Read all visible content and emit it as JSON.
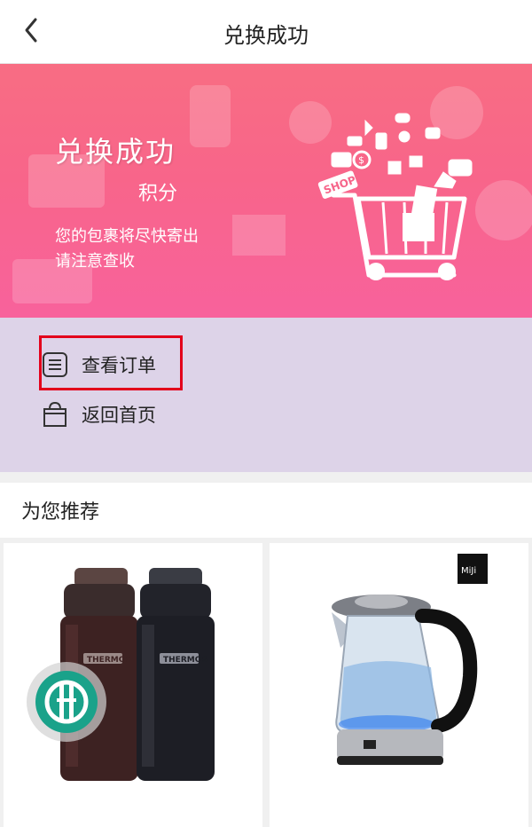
{
  "header": {
    "title": "兑换成功"
  },
  "banner": {
    "title": "兑换成功",
    "points_label": "积分",
    "line1": "您的包裹将尽快寄出",
    "line2": "请注意查收",
    "shop_tag": "SHOP"
  },
  "actions": {
    "view_order": "查看订单",
    "back_home": "返回首页"
  },
  "recommend": {
    "heading": "为您推荐",
    "products": [
      {
        "name": "thermos-bottles",
        "brand_mark": "THERMOS"
      },
      {
        "name": "glass-kettle",
        "brand_mark": "MiJi"
      }
    ]
  },
  "colors": {
    "banner_start": "#f86d83",
    "banner_end": "#f8629c",
    "actions_bg": "#ddd3e8",
    "highlight": "#e3001b",
    "float_button": "#1aa28a"
  }
}
